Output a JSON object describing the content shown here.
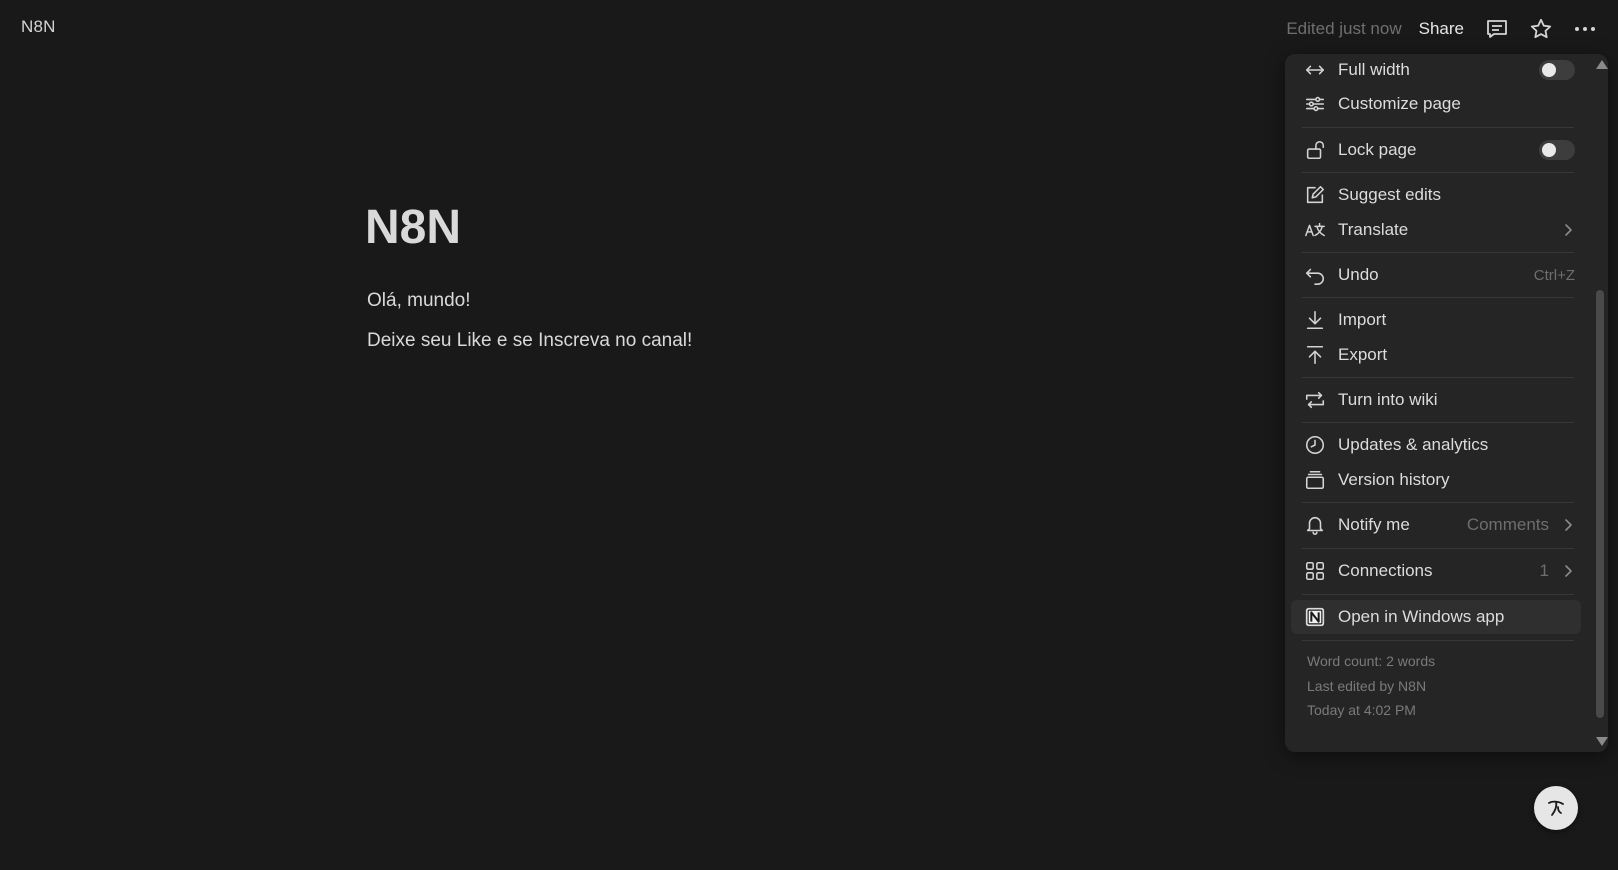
{
  "topbar": {
    "breadcrumb": "N8N",
    "edited_status": "Edited just now",
    "share_label": "Share",
    "icons": [
      "comment-icon",
      "star-icon",
      "more-icon"
    ]
  },
  "page": {
    "title": "N8N",
    "paragraphs": [
      "Olá, mundo!",
      "Deixe seu Like e se Inscreva no canal!"
    ]
  },
  "menu": {
    "full_width": "Full width",
    "customize_page": "Customize page",
    "lock_page": "Lock page",
    "suggest_edits": "Suggest edits",
    "translate": "Translate",
    "undo": "Undo",
    "undo_shortcut": "Ctrl+Z",
    "import": "Import",
    "export": "Export",
    "turn_into_wiki": "Turn into wiki",
    "updates_analytics": "Updates & analytics",
    "version_history": "Version history",
    "notify_me": "Notify me",
    "notify_value": "Comments",
    "connections": "Connections",
    "connections_count": "1",
    "open_windows_app": "Open in Windows app",
    "toggles": {
      "full_width_on": false,
      "lock_page_on": false
    }
  },
  "footer": {
    "word_count": "Word count: 2 words",
    "last_edited": "Last edited by N8N",
    "edited_time": "Today at 4:02 PM"
  },
  "colors": {
    "background": "#191919",
    "menu_background": "#252525",
    "text": "#d4d4d4",
    "muted": "#6f6f6f"
  }
}
